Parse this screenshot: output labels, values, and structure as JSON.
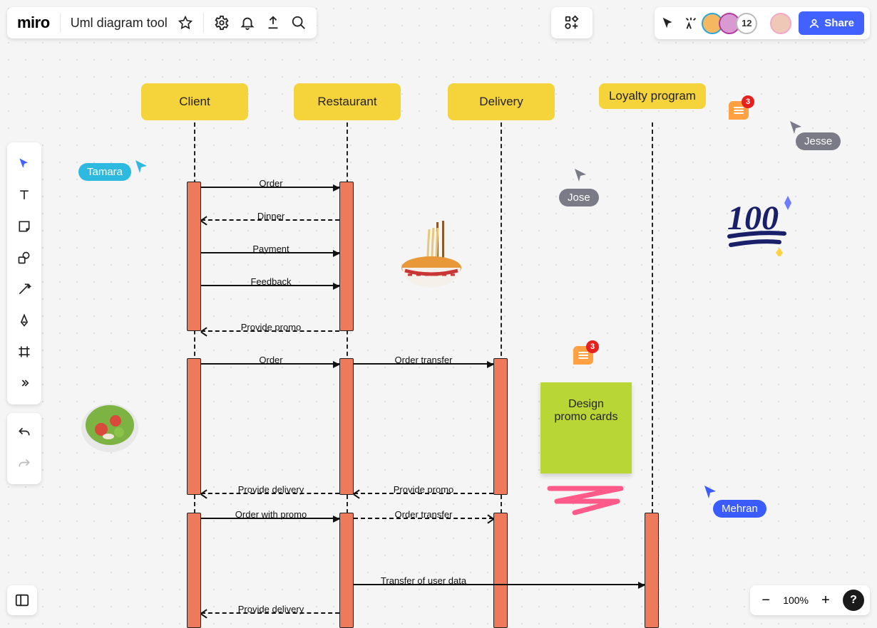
{
  "header": {
    "logo": "miro",
    "board_title": "Uml diagram tool",
    "share_label": "Share",
    "more_users_count": "12"
  },
  "zoom": {
    "value": "100%"
  },
  "help_label": "?",
  "actors": {
    "client": "Client",
    "restaurant": "Restaurant",
    "delivery": "Delivery",
    "loyalty": "Loyalty program"
  },
  "messages": {
    "order1": "Order",
    "dinner": "Dinner",
    "payment": "Payment",
    "feedback": "Feedback",
    "provide_promo1": "Provide promo",
    "order2": "Order",
    "order_transfer1": "Order transfer",
    "provide_delivery1": "Provide delivery",
    "provide_promo2": "Provide promo",
    "order_with_promo": "Order with promo",
    "order_transfer2": "Order transfer",
    "transfer_user_data": "Transfer of user data",
    "provide_delivery2": "Provide delivery"
  },
  "sticky": {
    "design_promo": "Design promo cards"
  },
  "comments": {
    "top_count": "3",
    "mid_count": "3"
  },
  "cursors": {
    "tamara": "Tamara",
    "jose": "Jose",
    "jesse": "Jesse",
    "mehran": "Mehran"
  }
}
